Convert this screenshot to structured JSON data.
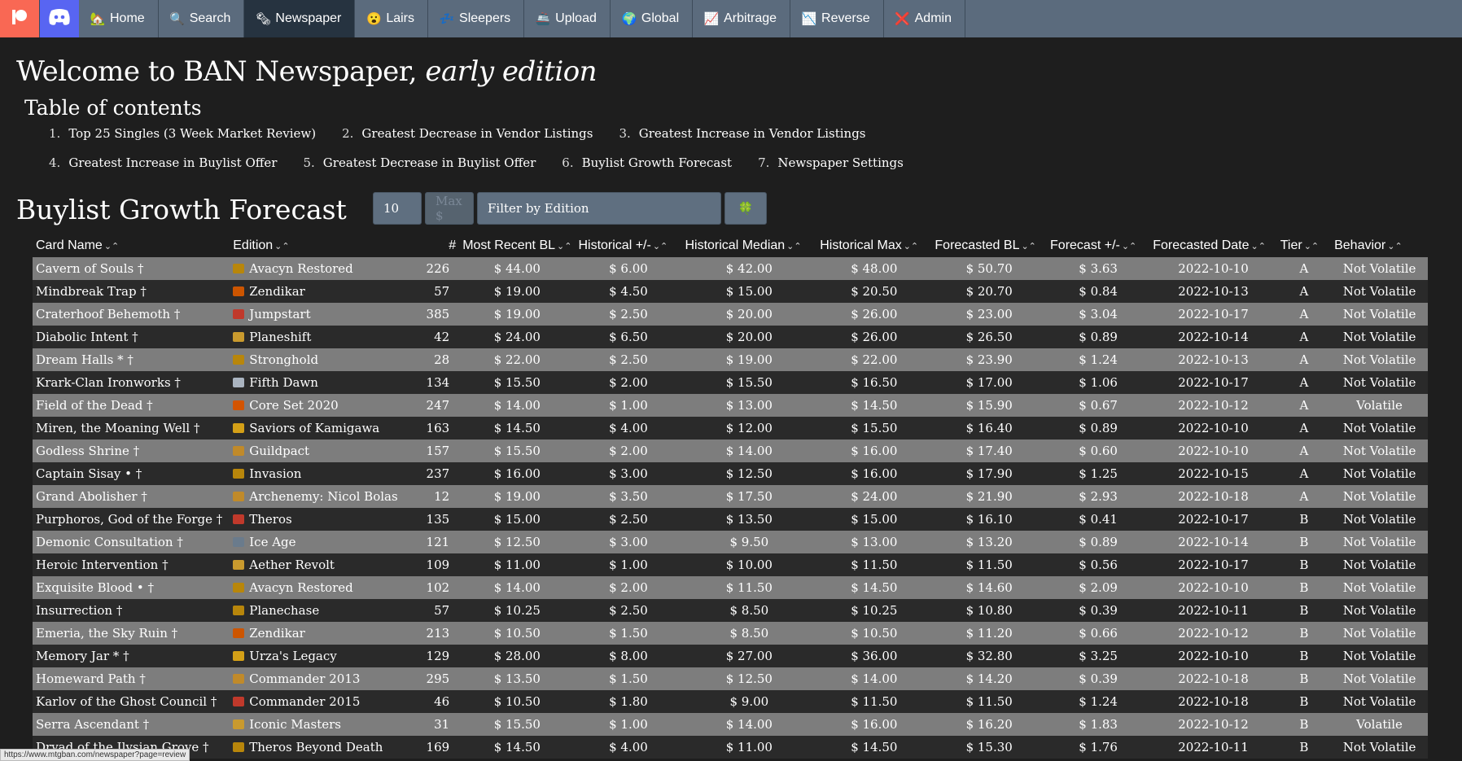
{
  "nav": {
    "brand_patreon_icon": "patreon-icon",
    "brand_discord_icon": "discord-icon",
    "items": [
      {
        "label": "Home",
        "icon": "🏡"
      },
      {
        "label": "Search",
        "icon": "🔍"
      },
      {
        "label": "Newspaper",
        "icon": "🗞"
      },
      {
        "label": "Lairs",
        "icon": "😮"
      },
      {
        "label": "Sleepers",
        "icon": "💤"
      },
      {
        "label": "Upload",
        "icon": "🚢"
      },
      {
        "label": "Global",
        "icon": "🌍"
      },
      {
        "label": "Arbitrage",
        "icon": "📈"
      },
      {
        "label": "Reverse",
        "icon": "📉"
      },
      {
        "label": "Admin",
        "icon": "❌"
      }
    ],
    "active": "Newspaper"
  },
  "page": {
    "title_main": "Welcome to BAN Newspaper,",
    "title_em": "early edition",
    "toc_title": "Table of contents",
    "toc_row1": [
      {
        "num": "1.",
        "label": "Top 25 Singles (3 Week Market Review)"
      },
      {
        "num": "2.",
        "label": "Greatest Decrease in Vendor Listings"
      },
      {
        "num": "3.",
        "label": "Greatest Increase in Vendor Listings"
      }
    ],
    "toc_row2": [
      {
        "num": "4.",
        "label": "Greatest Increase in Buylist Offer"
      },
      {
        "num": "5.",
        "label": "Greatest Decrease in Buylist Offer"
      },
      {
        "num": "6.",
        "label": "Buylist Growth Forecast"
      },
      {
        "num": "7.",
        "label": "Newspaper Settings"
      }
    ]
  },
  "section": {
    "title": "Buylist Growth Forecast",
    "min_value": "10",
    "max_placeholder": "Max $",
    "filter_placeholder": "Filter by Edition",
    "filter_button_icon": "clover-icon",
    "filter_button_glyph": "🍀"
  },
  "table": {
    "headers": [
      "Card Name",
      "Edition",
      "#",
      "Most Recent BL",
      "Historical +/-",
      "Historical Median",
      "Historical Max",
      "Forecasted BL",
      "Forecast +/-",
      "Forecasted Date",
      "Tier",
      "Behavior"
    ],
    "rows": [
      [
        "Cavern of Souls †",
        "Avacyn Restored",
        "226",
        "$ 44.00",
        "$ 6.00",
        "$ 42.00",
        "$ 48.00",
        "$ 50.70",
        "$ 3.63",
        "2022-10-10",
        "A",
        "Not Volatile"
      ],
      [
        "Mindbreak Trap †",
        "Zendikar",
        "57",
        "$ 19.00",
        "$ 4.50",
        "$ 15.00",
        "$ 20.50",
        "$ 20.70",
        "$ 0.84",
        "2022-10-13",
        "A",
        "Not Volatile"
      ],
      [
        "Craterhoof Behemoth †",
        "Jumpstart",
        "385",
        "$ 19.00",
        "$ 2.50",
        "$ 20.00",
        "$ 26.00",
        "$ 23.00",
        "$ 3.04",
        "2022-10-17",
        "A",
        "Not Volatile"
      ],
      [
        "Diabolic Intent †",
        "Planeshift",
        "42",
        "$ 24.00",
        "$ 6.50",
        "$ 20.00",
        "$ 26.00",
        "$ 26.50",
        "$ 0.89",
        "2022-10-14",
        "A",
        "Not Volatile"
      ],
      [
        "Dream Halls * †",
        "Stronghold",
        "28",
        "$ 22.00",
        "$ 2.50",
        "$ 19.00",
        "$ 22.00",
        "$ 23.90",
        "$ 1.24",
        "2022-10-13",
        "A",
        "Not Volatile"
      ],
      [
        "Krark-Clan Ironworks †",
        "Fifth Dawn",
        "134",
        "$ 15.50",
        "$ 2.00",
        "$ 15.50",
        "$ 16.50",
        "$ 17.00",
        "$ 1.06",
        "2022-10-17",
        "A",
        "Not Volatile"
      ],
      [
        "Field of the Dead †",
        "Core Set 2020",
        "247",
        "$ 14.00",
        "$ 1.00",
        "$ 13.00",
        "$ 14.50",
        "$ 15.90",
        "$ 0.67",
        "2022-10-12",
        "A",
        "Volatile"
      ],
      [
        "Miren, the Moaning Well †",
        "Saviors of Kamigawa",
        "163",
        "$ 14.50",
        "$ 4.00",
        "$ 12.00",
        "$ 15.50",
        "$ 16.40",
        "$ 0.89",
        "2022-10-10",
        "A",
        "Not Volatile"
      ],
      [
        "Godless Shrine †",
        "Guildpact",
        "157",
        "$ 15.50",
        "$ 2.00",
        "$ 14.00",
        "$ 16.00",
        "$ 17.40",
        "$ 0.60",
        "2022-10-10",
        "A",
        "Not Volatile"
      ],
      [
        "Captain Sisay • †",
        "Invasion",
        "237",
        "$ 16.00",
        "$ 3.00",
        "$ 12.50",
        "$ 16.00",
        "$ 17.90",
        "$ 1.25",
        "2022-10-15",
        "A",
        "Not Volatile"
      ],
      [
        "Grand Abolisher †",
        "Archenemy: Nicol Bolas",
        "12",
        "$ 19.00",
        "$ 3.50",
        "$ 17.50",
        "$ 24.00",
        "$ 21.90",
        "$ 2.93",
        "2022-10-18",
        "A",
        "Not Volatile"
      ],
      [
        "Purphoros, God of the Forge †",
        "Theros",
        "135",
        "$ 15.00",
        "$ 2.50",
        "$ 13.50",
        "$ 15.00",
        "$ 16.10",
        "$ 0.41",
        "2022-10-17",
        "B",
        "Not Volatile"
      ],
      [
        "Demonic Consultation †",
        "Ice Age",
        "121",
        "$ 12.50",
        "$ 3.00",
        "$ 9.50",
        "$ 13.00",
        "$ 13.20",
        "$ 0.89",
        "2022-10-14",
        "B",
        "Not Volatile"
      ],
      [
        "Heroic Intervention †",
        "Aether Revolt",
        "109",
        "$ 11.00",
        "$ 1.00",
        "$ 10.00",
        "$ 11.50",
        "$ 11.50",
        "$ 0.56",
        "2022-10-17",
        "B",
        "Not Volatile"
      ],
      [
        "Exquisite Blood • †",
        "Avacyn Restored",
        "102",
        "$ 14.00",
        "$ 2.00",
        "$ 11.50",
        "$ 14.50",
        "$ 14.60",
        "$ 2.09",
        "2022-10-10",
        "B",
        "Not Volatile"
      ],
      [
        "Insurrection †",
        "Planechase",
        "57",
        "$ 10.25",
        "$ 2.50",
        "$ 8.50",
        "$ 10.25",
        "$ 10.80",
        "$ 0.39",
        "2022-10-11",
        "B",
        "Not Volatile"
      ],
      [
        "Emeria, the Sky Ruin †",
        "Zendikar",
        "213",
        "$ 10.50",
        "$ 1.50",
        "$ 8.50",
        "$ 10.50",
        "$ 11.20",
        "$ 0.66",
        "2022-10-12",
        "B",
        "Not Volatile"
      ],
      [
        "Memory Jar * †",
        "Urza's Legacy",
        "129",
        "$ 28.00",
        "$ 8.00",
        "$ 27.00",
        "$ 36.00",
        "$ 32.80",
        "$ 3.25",
        "2022-10-10",
        "B",
        "Not Volatile"
      ],
      [
        "Homeward Path †",
        "Commander 2013",
        "295",
        "$ 13.50",
        "$ 1.50",
        "$ 12.50",
        "$ 14.00",
        "$ 14.20",
        "$ 0.39",
        "2022-10-18",
        "B",
        "Not Volatile"
      ],
      [
        "Karlov of the Ghost Council †",
        "Commander 2015",
        "46",
        "$ 10.50",
        "$ 1.80",
        "$ 9.00",
        "$ 11.50",
        "$ 11.50",
        "$ 1.24",
        "2022-10-18",
        "B",
        "Not Volatile"
      ],
      [
        "Serra Ascendant †",
        "Iconic Masters",
        "31",
        "$ 15.50",
        "$ 1.00",
        "$ 14.00",
        "$ 16.00",
        "$ 16.20",
        "$ 1.83",
        "2022-10-12",
        "B",
        "Volatile"
      ],
      [
        "Dryad of the Ilysian Grove †",
        "Theros Beyond Death",
        "169",
        "$ 14.50",
        "$ 4.00",
        "$ 11.00",
        "$ 14.50",
        "$ 15.30",
        "$ 1.76",
        "2022-10-11",
        "B",
        "Not Volatile"
      ]
    ],
    "set_colors": {
      "Avacyn Restored": "#b8860b",
      "Zendikar": "#cc5500",
      "Jumpstart": "#c0392b",
      "Planeshift": "#c99a2e",
      "Stronghold": "#b8860b",
      "Fifth Dawn": "#aab4c0",
      "Core Set 2020": "#d35400",
      "Saviors of Kamigawa": "#d4a017",
      "Guildpact": "#c08a2a",
      "Invasion": "#b8860b",
      "Archenemy: Nicol Bolas": "#c08a2a",
      "Theros": "#c0392b",
      "Ice Age": "#6a7b8c",
      "Aether Revolt": "#c99a2e",
      "Planechase": "#b8860b",
      "Urza's Legacy": "#d4a017",
      "Commander 2013": "#c08a2a",
      "Commander 2015": "#c0392b",
      "Iconic Masters": "#c99a2e",
      "Theros Beyond Death": "#b8860b"
    }
  },
  "status_url": "https://www.mtgban.com/newspaper?page=review"
}
